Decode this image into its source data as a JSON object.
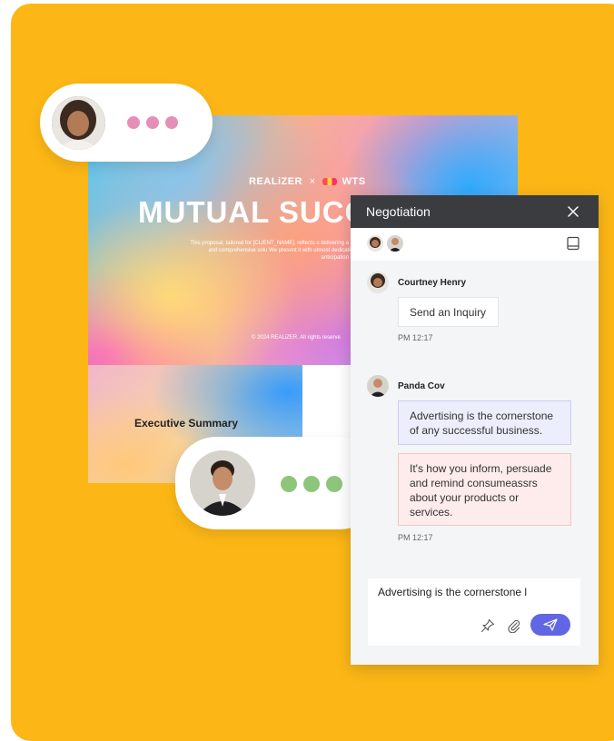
{
  "proposal": {
    "brand_left": "REALiZER",
    "brand_sep": "×",
    "brand_right": "WTS",
    "title": "MUTUAL SUCCE",
    "description": "This proposal, tailored for [CLIENT_NAME], reflects o delivering a refined and comprehensive solu We present it with utmost dedication and anticipation of your",
    "copyright": "© 2024 REALiZER. All rights reserve",
    "exec_summary": "Executive Summary"
  },
  "typing_indicators": [
    {
      "avatar": "woman-avatar",
      "dot_color": "#e58fb7"
    },
    {
      "avatar": "man-avatar",
      "dot_color": "#8dc67a"
    }
  ],
  "chat": {
    "title": "Negotiation",
    "messages": [
      {
        "sender": "Courtney Henry",
        "bubbles": [
          "Send an Inquiry"
        ],
        "time": "PM 12:17"
      },
      {
        "sender": "Panda Cov",
        "bubbles": [
          "Advertising is the cornerstone of any successful business.",
          "It's how you inform, persuade and remind consumeassrs about your products or services."
        ],
        "time": "PM 12:17"
      }
    ],
    "composer": {
      "value": "Advertising is the cornerstone l"
    },
    "accent": "#6066e4"
  },
  "colors": {
    "background": "#fcb716",
    "header": "#3b3c40"
  }
}
